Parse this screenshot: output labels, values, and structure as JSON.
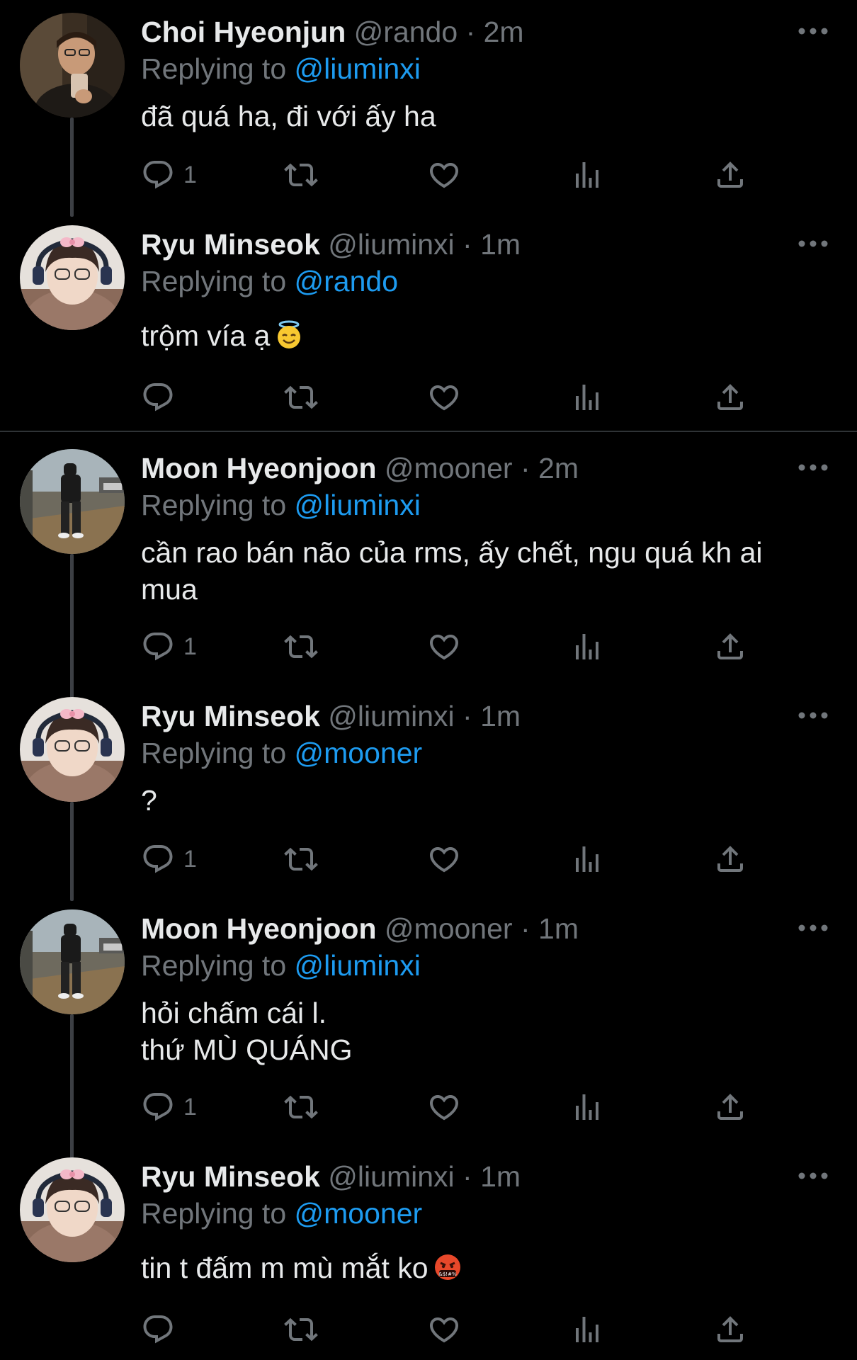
{
  "tweets": [
    {
      "name": "Choi Hyeonjun",
      "handle": "@rando",
      "dot": "·",
      "time": "2m",
      "replying_label": "Replying to",
      "replying_to": "@liuminxi",
      "text": "đã quá ha, đi với ấy ha",
      "reply_count": "1"
    },
    {
      "name": "Ryu Minseok",
      "handle": "@liuminxi",
      "dot": "·",
      "time": "1m",
      "replying_label": "Replying to",
      "replying_to": "@rando",
      "text": "trộm vía ạ",
      "emoji": "smiling-face-with-halo",
      "reply_count": ""
    },
    {
      "name": "Moon Hyeonjoon",
      "handle": "@mooner",
      "dot": "·",
      "time": "2m",
      "replying_label": "Replying to",
      "replying_to": "@liuminxi",
      "text_line1": "cần rao bán não của rms, ấy chết, ngu quá kh ai",
      "text_line2": "mua",
      "reply_count": "1"
    },
    {
      "name": "Ryu Minseok",
      "handle": "@liuminxi",
      "dot": "·",
      "time": "1m",
      "replying_label": "Replying to",
      "replying_to": "@mooner",
      "text": "?",
      "reply_count": "1"
    },
    {
      "name": "Moon Hyeonjoon",
      "handle": "@mooner",
      "dot": "·",
      "time": "1m",
      "replying_label": "Replying to",
      "replying_to": "@liuminxi",
      "text_line1": "hỏi chấm cái l.",
      "text_line2": "thứ MÙ QUÁNG",
      "reply_count": "1"
    },
    {
      "name": "Ryu Minseok",
      "handle": "@liuminxi",
      "dot": "·",
      "time": "1m",
      "replying_label": "Replying to",
      "replying_to": "@mooner",
      "text": "tin t đấm m mù mắt ko",
      "emoji": "face-with-symbols-on-mouth",
      "reply_count": ""
    }
  ],
  "icons": {
    "reply": "reply-icon",
    "retweet": "retweet-icon",
    "like": "heart-icon",
    "views": "views-icon",
    "share": "share-icon",
    "more": "more-icon"
  },
  "colors": {
    "background": "#000000",
    "text": "#e7e9ea",
    "secondary": "#71767b",
    "link": "#1d9bf0",
    "divider": "#2f3336"
  }
}
